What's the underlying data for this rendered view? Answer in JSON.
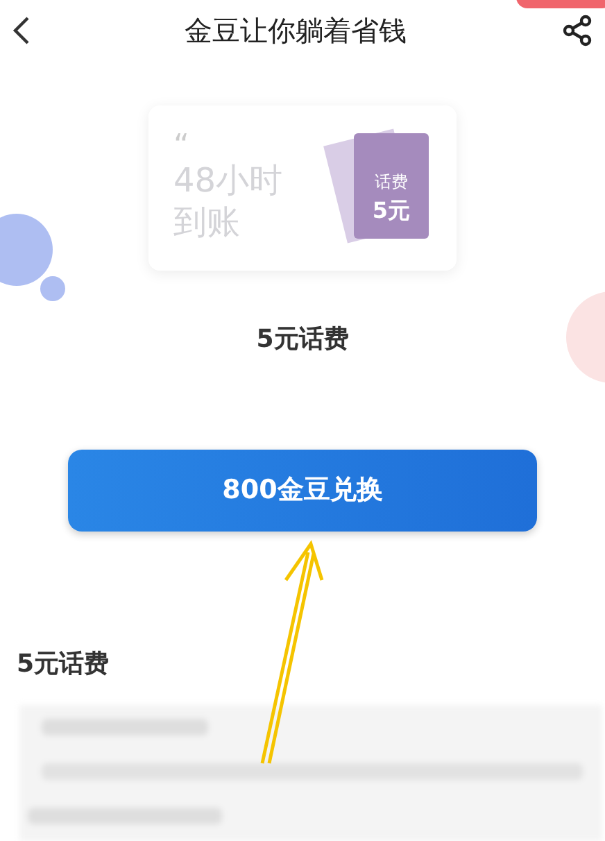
{
  "header": {
    "title": "金豆让你躺着省钱"
  },
  "card": {
    "quote_mark": "“",
    "text": "48小时到账",
    "ticket": {
      "label": "话费",
      "amount": "5元"
    }
  },
  "product_name": "5元话费",
  "exchange_button": "800金豆兑换",
  "details": {
    "title": "5元话费"
  }
}
